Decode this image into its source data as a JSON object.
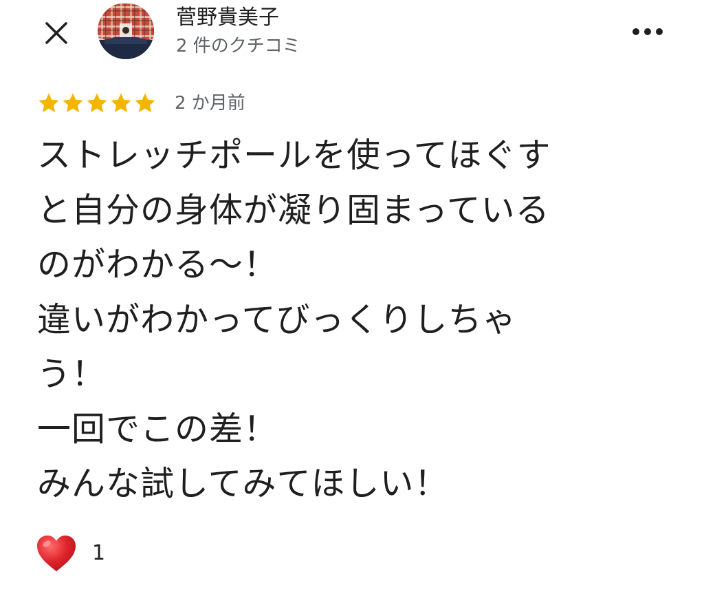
{
  "header": {
    "close_icon": "close-icon",
    "more_icon": "more-horizontal-icon"
  },
  "author": {
    "name": "菅野貴美子",
    "review_count": "2 件のクチコミ",
    "avatar_icon": "avatar-photo"
  },
  "rating": {
    "stars": 5,
    "max_stars": 5,
    "star_color": "#f4b400",
    "date": "2 か月前"
  },
  "review": {
    "text": "ストレッチポールを使ってほぐす\nと自分の身体が凝り固まっている\nのがわかる〜！\n違いがわかってびっくりしちゃ\nう！\n一回でこの差！\nみんな試してみてほしい！"
  },
  "reaction": {
    "icon": "heart-icon",
    "color": "#e0262d",
    "count": "1"
  }
}
